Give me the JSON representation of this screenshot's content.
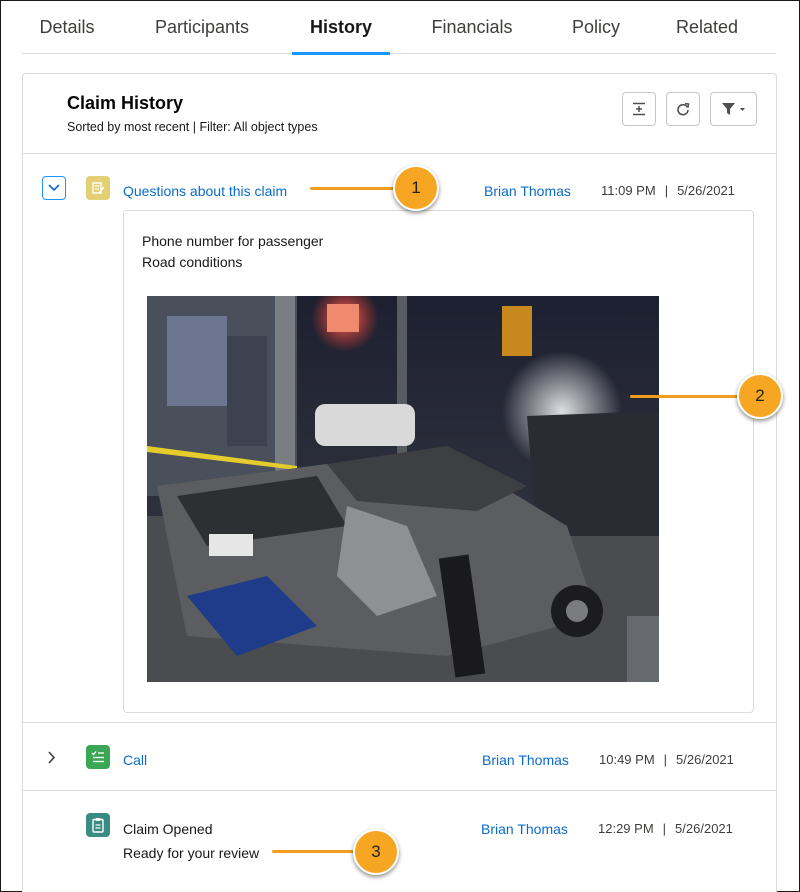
{
  "tabs": [
    {
      "label": "Details"
    },
    {
      "label": "Participants"
    },
    {
      "label": "History",
      "active": true
    },
    {
      "label": "Financials"
    },
    {
      "label": "Policy"
    },
    {
      "label": "Related"
    }
  ],
  "header": {
    "title": "Claim History",
    "subtitle": "Sorted by most recent | Filter: All object types",
    "buttons": [
      {
        "icon": "collapse-all-icon"
      },
      {
        "icon": "refresh-icon"
      },
      {
        "icon": "filter-icon"
      }
    ]
  },
  "history": [
    {
      "title": "Questions about this claim",
      "owner": "Brian Thomas",
      "time": "11:09 PM",
      "date": "5/26/2021",
      "expanded": true,
      "icon": "note-icon",
      "icon_color": "#e3cf76",
      "details": [
        "Phone number for passenger",
        "Road conditions"
      ],
      "attachment": "car-accident-photo"
    },
    {
      "title": "Call",
      "owner": "Brian Thomas",
      "time": "10:49 PM",
      "date": "5/26/2021",
      "expanded": false,
      "icon": "task-icon",
      "icon_color": "#3ba755"
    },
    {
      "title": "Claim Opened",
      "subtitle": "Ready for your review",
      "owner": "Brian Thomas",
      "time": "12:29 PM",
      "date": "5/26/2021",
      "icon": "clipboard-icon",
      "icon_color": "#3a8b84"
    }
  ],
  "callouts": [
    "1",
    "2",
    "3"
  ],
  "separator": "|",
  "colors": {
    "link": "#0b6bcb",
    "active_tab": "#1b96ff",
    "callout": "#f6a623"
  }
}
